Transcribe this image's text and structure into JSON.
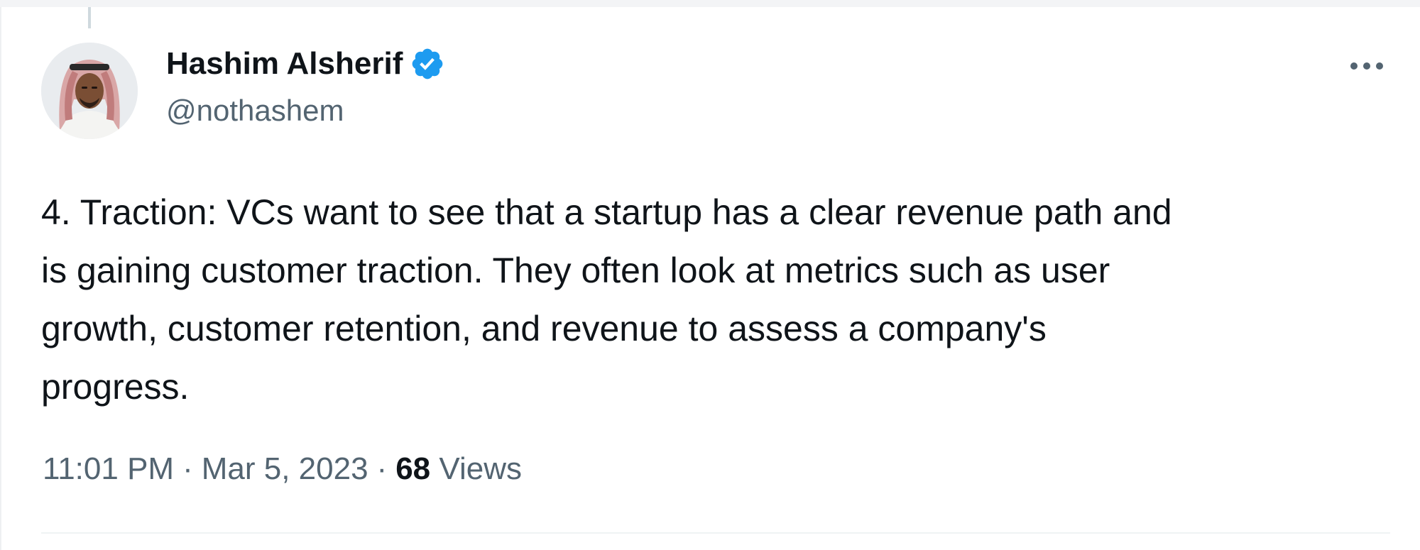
{
  "tweet": {
    "author": {
      "display_name": "Hashim Alsherif",
      "handle": "@nothashem",
      "verified": true,
      "verified_icon": "verified-badge-icon",
      "avatar_icon": "avatar-image"
    },
    "more_icon": "more-options-icon",
    "text_lines": [
      "4. Traction: VCs want to see that a startup has a clear revenue path and",
      "is gaining customer traction. They often look at metrics such as user",
      "growth, customer retention, and revenue to assess a company's",
      "progress."
    ],
    "meta": {
      "time": "11:01 PM",
      "separator": "·",
      "date": "Mar 5, 2023",
      "views_count": "68",
      "views_label": "Views"
    }
  },
  "colors": {
    "text_primary": "#0f1419",
    "text_secondary": "#536471",
    "verified_blue": "#1d9bf0",
    "divider": "#eff3f4"
  }
}
